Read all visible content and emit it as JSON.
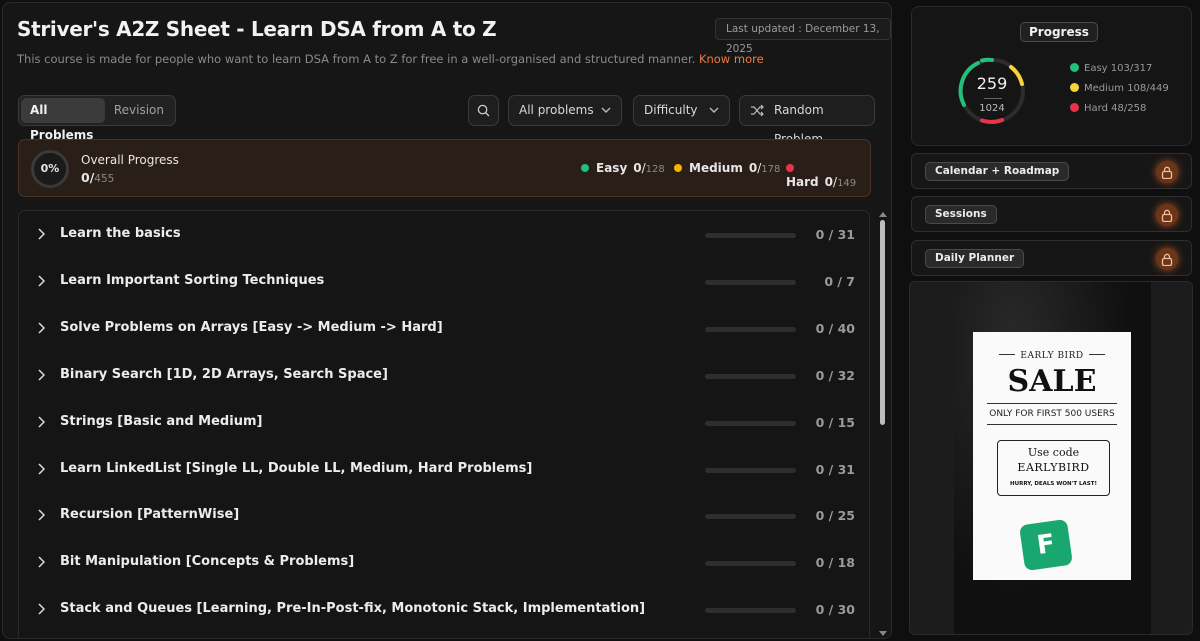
{
  "header": {
    "title": "Striver's A2Z Sheet - Learn DSA from A to Z",
    "last_updated": "Last updated : December 13, 2025",
    "subtitle": "This course is made for people who want to learn DSA from A to Z for free in a well-organised and structured manner.",
    "know_more": "Know more"
  },
  "toolbar": {
    "tabs": [
      "All Problems",
      "Revision"
    ],
    "active_tab": "All Problems",
    "filter_label": "All problems",
    "difficulty_label": "Difficulty",
    "random_label": "Random Problem"
  },
  "overall": {
    "percent": "0%",
    "label": "Overall Progress",
    "done": "0",
    "total": "455",
    "easy": {
      "label": "Easy",
      "done": "0",
      "total": "128",
      "color": "#22c07a"
    },
    "medium": {
      "label": "Medium",
      "done": "0",
      "total": "178",
      "color": "#f5b400"
    },
    "hard": {
      "label": "Hard",
      "done": "0",
      "total": "149",
      "color": "#e8344a"
    }
  },
  "topics": [
    {
      "label": "Learn the basics",
      "progress": "0 / 31"
    },
    {
      "label": "Learn Important Sorting Techniques",
      "progress": "0 / 7"
    },
    {
      "label": "Solve Problems on Arrays [Easy -> Medium -> Hard]",
      "progress": "0 / 40"
    },
    {
      "label": "Binary Search [1D, 2D Arrays, Search Space]",
      "progress": "0 / 32"
    },
    {
      "label": "Strings [Basic and Medium]",
      "progress": "0 / 15"
    },
    {
      "label": "Learn LinkedList [Single LL, Double LL, Medium, Hard Problems]",
      "progress": "0 / 31"
    },
    {
      "label": "Recursion [PatternWise]",
      "progress": "0 / 25"
    },
    {
      "label": "Bit Manipulation [Concepts & Problems]",
      "progress": "0 / 18"
    },
    {
      "label": "Stack and Queues [Learning, Pre-In-Post-fix, Monotonic Stack, Implementation]",
      "progress": "0 / 30"
    }
  ],
  "sidebar": {
    "progress_title": "Progress",
    "solved": "259",
    "total": "1024",
    "legend": [
      {
        "label": "Easy",
        "value": "103/317",
        "color": "#22c07a"
      },
      {
        "label": "Medium",
        "value": "108/449",
        "color": "#f5d33a"
      },
      {
        "label": "Hard",
        "value": "48/258",
        "color": "#e8344a"
      }
    ],
    "locked": [
      "Calendar + Roadmap",
      "Sessions",
      "Daily Planner"
    ]
  },
  "ad": {
    "early": "EARLY BIRD",
    "sale": "SALE",
    "only": "ONLY FOR FIRST 500 USERS",
    "use_code": "Use code",
    "code": "EARLYBIRD",
    "hurry": "HURRY, DEALS WON'T LAST!"
  }
}
